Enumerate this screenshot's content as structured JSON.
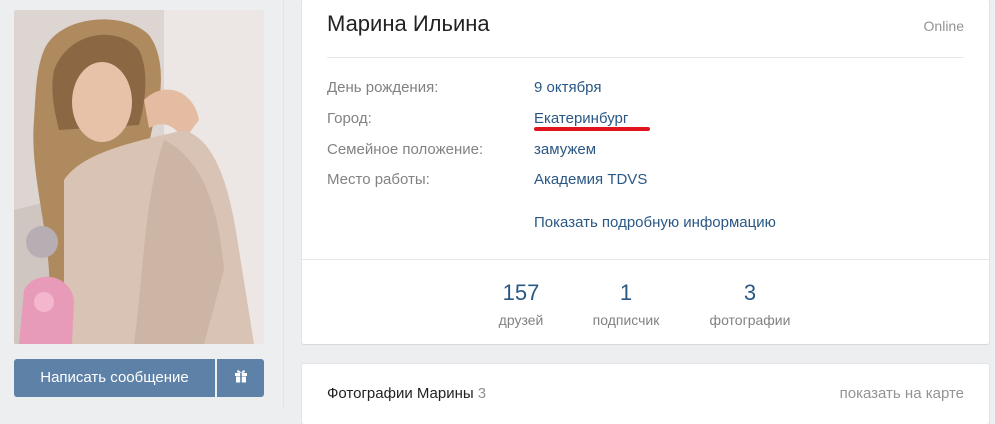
{
  "profile": {
    "name": "Марина Ильина",
    "status": "Online",
    "info": [
      {
        "label": "День рождения:",
        "value": "9 октября"
      },
      {
        "label": "Город:",
        "value": "Екатеринбург"
      },
      {
        "label": "Семейное положение:",
        "value": "замужем"
      },
      {
        "label": "Место работы:",
        "value": "Академия TDVS"
      }
    ],
    "show_more": "Показать подробную информацию",
    "counters": [
      {
        "value": "157",
        "label": "друзей"
      },
      {
        "value": "1",
        "label": "подписчик"
      },
      {
        "value": "3",
        "label": "фотографии"
      }
    ]
  },
  "actions": {
    "message_label": "Написать сообщение",
    "gift_icon": "gift-icon"
  },
  "photos": {
    "title": "Фотографии Марины",
    "count": "3",
    "map_link": "показать на карте"
  },
  "colors": {
    "background": "#edeef0",
    "link": "#2a5885",
    "button": "#5e81a8",
    "highlight": "#e0141e"
  }
}
